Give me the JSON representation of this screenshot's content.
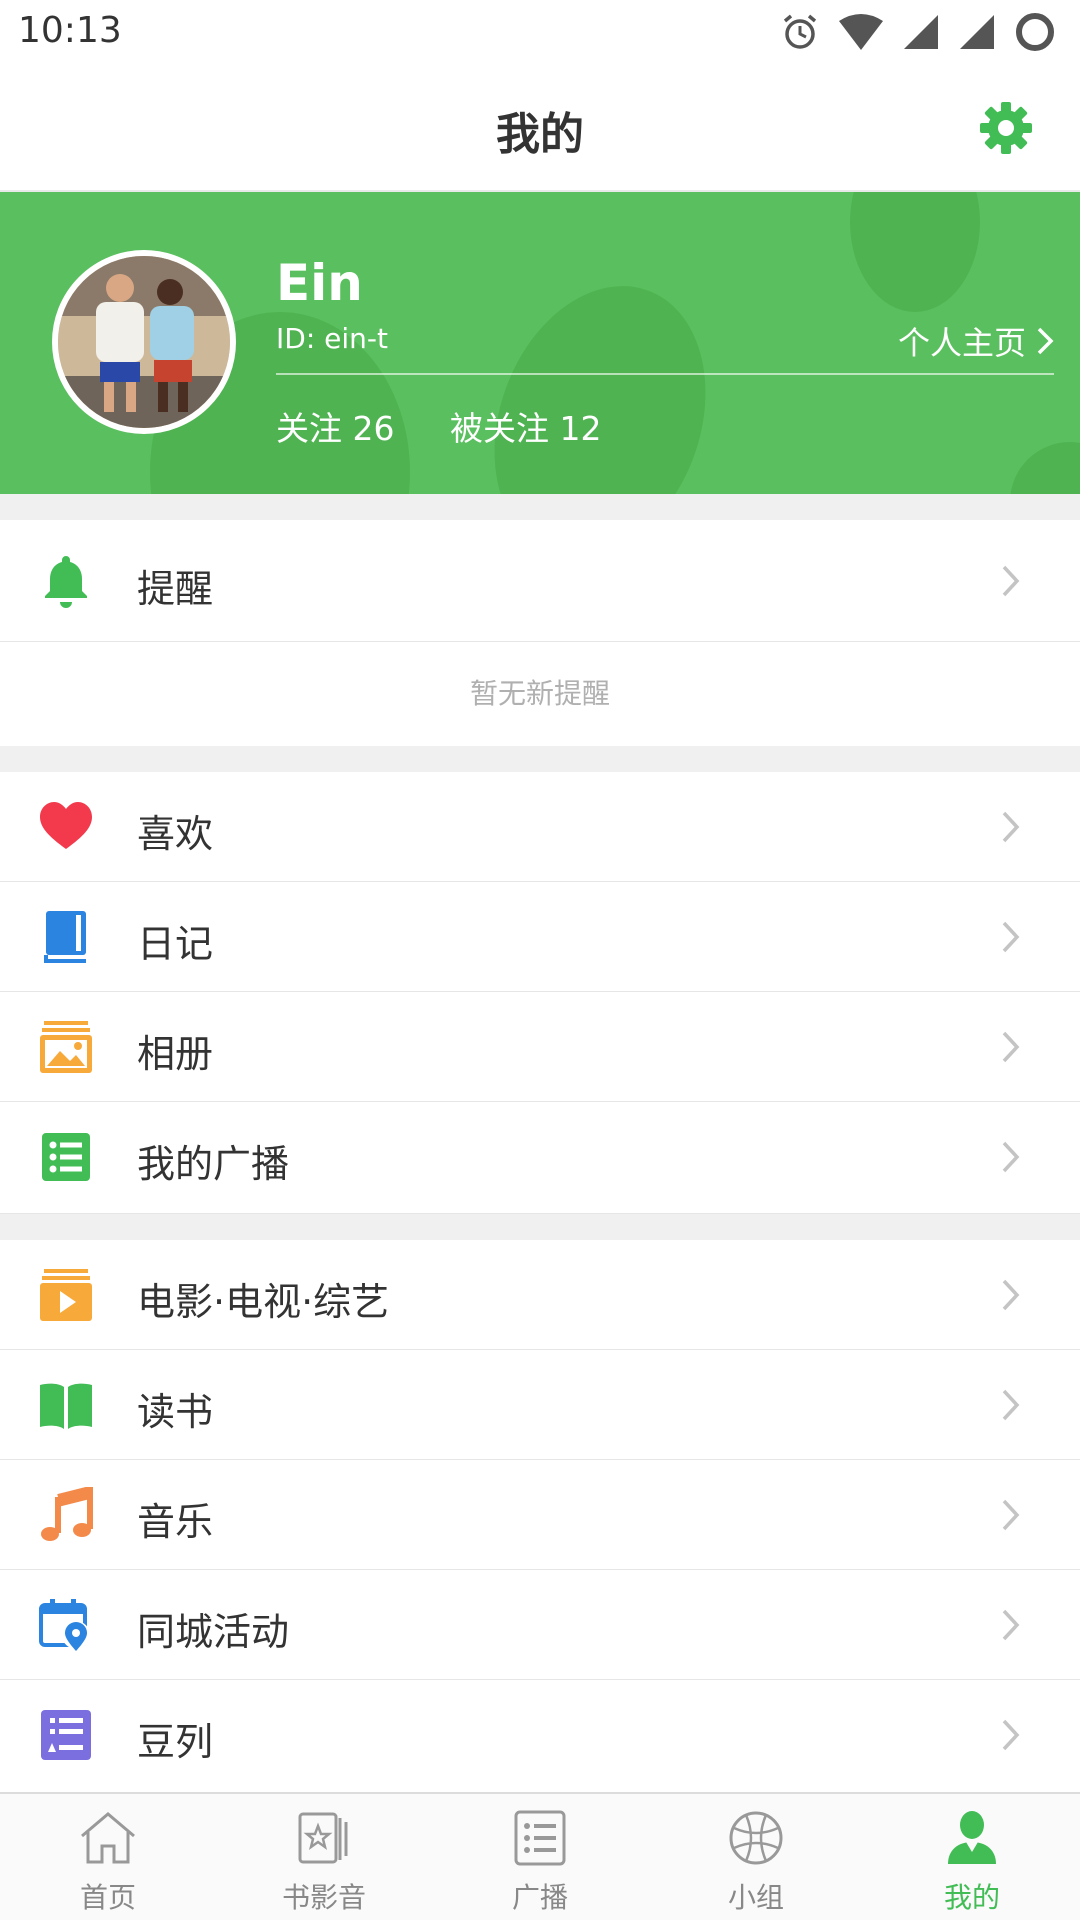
{
  "status_bar": {
    "time": "10:13"
  },
  "header": {
    "title": "我的"
  },
  "profile": {
    "name": "Ein",
    "id_text": "ID: ein-t",
    "homepage_label": "个人主页",
    "following": "关注 26",
    "followers": "被关注 12"
  },
  "reminder": {
    "label": "提醒",
    "empty_text": "暂无新提醒"
  },
  "menu_group_1": [
    {
      "label": "喜欢",
      "icon": "heart-icon"
    },
    {
      "label": "日记",
      "icon": "diary-book-icon"
    },
    {
      "label": "相册",
      "icon": "photo-album-icon"
    },
    {
      "label": "我的广播",
      "icon": "broadcast-list-icon"
    }
  ],
  "menu_group_2": [
    {
      "label": "电影·电视·综艺",
      "icon": "movie-play-icon"
    },
    {
      "label": "读书",
      "icon": "open-book-icon"
    },
    {
      "label": "音乐",
      "icon": "music-note-icon"
    },
    {
      "label": "同城活动",
      "icon": "calendar-location-icon"
    },
    {
      "label": "豆列",
      "icon": "doulist-icon"
    }
  ],
  "tabs": [
    {
      "label": "首页",
      "icon": "home-icon"
    },
    {
      "label": "书影音",
      "icon": "media-cards-icon"
    },
    {
      "label": "广播",
      "icon": "broadcast-icon"
    },
    {
      "label": "小组",
      "icon": "group-ball-icon"
    },
    {
      "label": "我的",
      "icon": "person-icon",
      "active": true
    }
  ],
  "colors": {
    "brand_green": "#42bd56",
    "profile_bg": "#5abf5e",
    "heart": "#f23a4c",
    "diary_blue": "#2b84e0",
    "album_orange": "#f7a93a",
    "music_orange": "#f38a4a",
    "doulist_purple": "#7b6fe0"
  }
}
